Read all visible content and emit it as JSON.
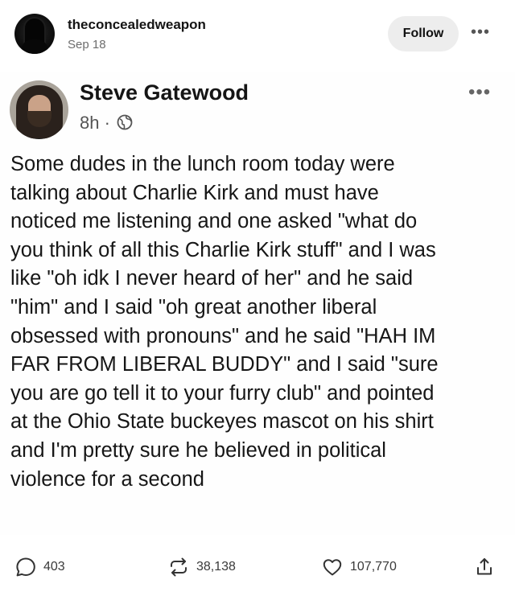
{
  "header": {
    "username": "theconcealedweapon",
    "date": "Sep 18",
    "follow_label": "Follow",
    "more_label": "•••"
  },
  "embedded_post": {
    "name": "Steve Gatewood",
    "time": "8h ·",
    "more_label": "•••",
    "text": "Some dudes in the lunch room today were\ntalking about Charlie Kirk and must have\nnoticed me listening and one asked \"what do\nyou think of all this Charlie Kirk stuff\" and I was\nlike \"oh idk I never heard of her\" and he said\n\"him\" and I said \"oh great another liberal\nobsessed with pronouns\" and he said \"HAH IM\nFAR FROM LIBERAL BUDDY\" and I said \"sure\nyou are go tell it to your furry club\" and pointed\nat the Ohio State buckeyes mascot on his shirt\nand I'm pretty sure he believed in political\nviolence for a second"
  },
  "actions": {
    "replies": "403",
    "reposts": "38,138",
    "likes": "107,770",
    "reply_icon": "speech-bubble-icon",
    "repost_icon": "repost-arrows-icon",
    "like_icon": "heart-icon",
    "share_icon": "share-upload-icon"
  }
}
